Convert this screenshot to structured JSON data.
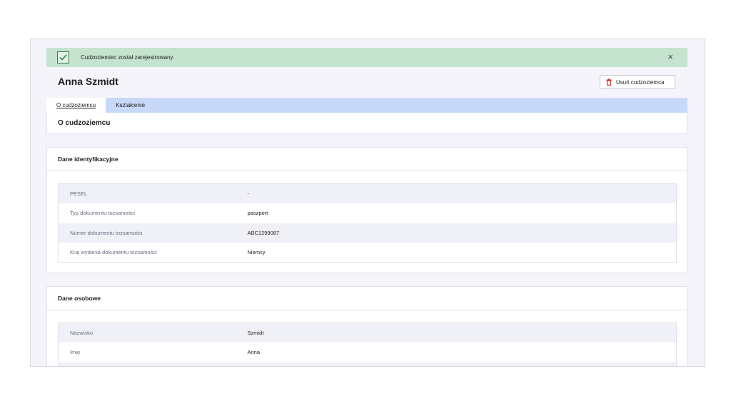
{
  "alert": {
    "message": "Cudzoziemiec został zarejestrowany.",
    "close_symbol": "×",
    "color": "#c5e3cf"
  },
  "person": {
    "name": "Anna Szmidt"
  },
  "actions": {
    "delete_label": "Usuń cudzoziemca",
    "delete_icon": "trash-icon",
    "delete_icon_color": "#d32f2f"
  },
  "tabs": [
    {
      "label": "O cudzoziemcu",
      "active": true
    },
    {
      "label": "Kształcenie",
      "active": false
    }
  ],
  "section": {
    "title": "O cudzoziemcu"
  },
  "identification": {
    "title": "Dane identyfikacyjne",
    "rows": [
      {
        "label": "PESEL",
        "value": "-"
      },
      {
        "label": "Typ dokumentu tożsamości",
        "value": "paszport"
      },
      {
        "label": "Numer dokumentu tożsamości",
        "value": "ABC1299087"
      },
      {
        "label": "Kraj wydania dokumentu tożsamości",
        "value": "Niemcy"
      }
    ]
  },
  "personal": {
    "title": "Dane osobowe",
    "rows": [
      {
        "label": "Nazwisko",
        "value": "Szmidt"
      },
      {
        "label": "Imię",
        "value": "Anna"
      }
    ]
  }
}
